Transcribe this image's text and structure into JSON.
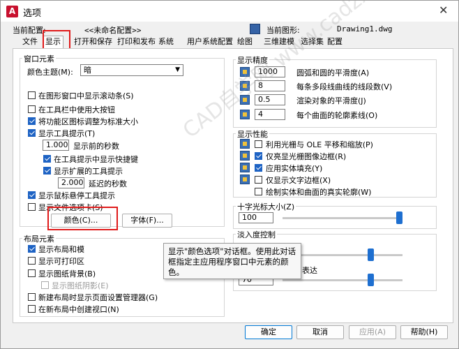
{
  "window": {
    "title": "选项",
    "close_glyph": "✕",
    "app_icon": "A"
  },
  "header": {
    "config_label": "当前配置:",
    "config_value": "<<未命名配置>>",
    "drawing_label": "当前图形:",
    "drawing_value": "Drawing1.dwg"
  },
  "tabs": [
    "文件",
    "显示",
    "打开和保存",
    "打印和发布",
    "系统",
    "用户系统配置",
    "绘图",
    "三维建模",
    "选择集",
    "配置"
  ],
  "window_elements": {
    "title": "窗口元素",
    "theme_label": "颜色主题(M):",
    "theme_value": "暗",
    "checks": [
      {
        "label": "在图形窗口中显示滚动条(S)",
        "checked": false
      },
      {
        "label": "在工具栏中使用大按钮",
        "checked": false
      },
      {
        "label": "将功能区图标调整为标准大小",
        "checked": true
      },
      {
        "label": "显示工具提示(T)",
        "checked": true
      }
    ],
    "tooltip_delay_value": "1.000",
    "tooltip_delay_label": "显示前的秒数",
    "sub_checks": [
      {
        "label": "在工具提示中显示快捷键",
        "checked": true
      },
      {
        "label": "显示扩展的工具提示",
        "checked": true
      }
    ],
    "ext_delay_value": "2.000",
    "ext_delay_label": "延迟的秒数",
    "checks2": [
      {
        "label": "显示鼠标悬停工具提示",
        "checked": true
      },
      {
        "label": "显示文件选项卡(S)",
        "checked": false
      }
    ],
    "colors_button": "颜色(C)...",
    "fonts_button": "字体(F)..."
  },
  "layout_elements": {
    "title": "布局元素",
    "checks": [
      {
        "label": "显示布局和模",
        "checked": true
      },
      {
        "label": "显示可打印区",
        "checked": false
      },
      {
        "label": "显示图纸背景(B)",
        "checked": false
      }
    ],
    "shadow_label": "显示图纸阴影(E)",
    "checks2": [
      {
        "label": "新建布局时显示页面设置管理器(G)",
        "checked": false
      },
      {
        "label": "在新布局中创建视口(N)",
        "checked": false
      }
    ]
  },
  "precision": {
    "title": "显示精度",
    "rows": [
      {
        "value": "1000",
        "label": "圆弧和圆的平滑度(A)"
      },
      {
        "value": "8",
        "label": "每条多段线曲线的线段数(V)"
      },
      {
        "value": "0.5",
        "label": "渲染对象的平滑度(J)"
      },
      {
        "value": "4",
        "label": "每个曲面的轮廓素线(O)"
      }
    ]
  },
  "performance": {
    "title": "显示性能",
    "checks": [
      {
        "label": "利用光栅与 OLE 平移和缩放(P)",
        "checked": false
      },
      {
        "label": "仅亮显光栅图像边框(R)",
        "checked": true
      },
      {
        "label": "应用实体填充(Y)",
        "checked": true
      },
      {
        "label": "仅显示文字边框(X)",
        "checked": false
      },
      {
        "label": "绘制实体和曲面的真实轮廓(W)",
        "checked": false
      }
    ]
  },
  "crosshair": {
    "title": "十字光标大小(Z)",
    "value": "100",
    "level": 1.0
  },
  "fade": {
    "title": "淡入度控制",
    "partial_label": "表达",
    "value": "70",
    "level1": 0.75,
    "level2": 0.75
  },
  "tooltip": {
    "text": "显示\"颜色选项\"对话框。使用此对话框指定主应用程序窗口中元素的颜色。"
  },
  "watermark": "CAD自学网 www.cadzxw.com",
  "footer": {
    "ok": "确定",
    "cancel": "取消",
    "apply": "应用(A)",
    "help": "帮助(H)"
  }
}
